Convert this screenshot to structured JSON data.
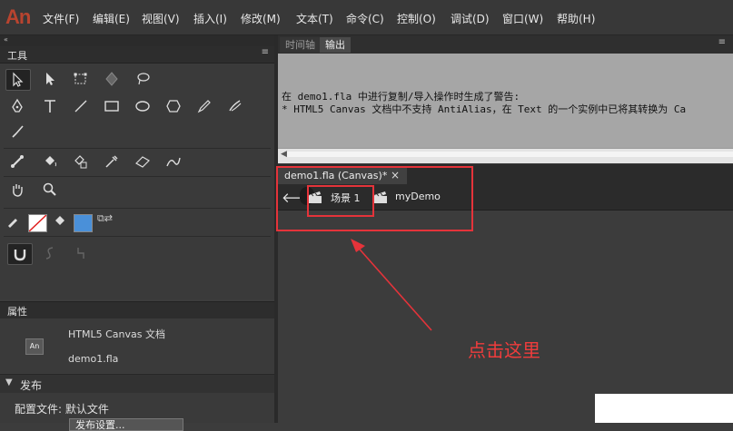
{
  "app": {
    "logo": "An",
    "menu": [
      "文件(F)",
      "编辑(E)",
      "视图(V)",
      "插入(I)",
      "修改(M)",
      "文本(T)",
      "命令(C)",
      "控制(O)",
      "调试(D)",
      "窗口(W)",
      "帮助(H)"
    ]
  },
  "tools_panel": {
    "collapse_icon": "«",
    "title": "工具",
    "menu_icon": "≡",
    "icons": [
      "selection-tool",
      "subselection-tool",
      "free-transform-tool",
      "3d-rotation-tool",
      "lasso-tool",
      "pen-tool",
      "text-tool",
      "line-tool",
      "rectangle-tool",
      "oval-tool",
      "polystar-tool",
      "pencil-tool",
      "brush-tool",
      "paint-brush-tool",
      "bone-tool",
      "paint-bucket-tool",
      "ink-bottle-tool",
      "eyedropper-tool",
      "eraser-tool",
      "width-tool",
      "hand-tool",
      "zoom-tool",
      "stroke-color",
      "fill-color",
      "swap-colors",
      "snap-to-objects",
      "smooth",
      "straighten"
    ],
    "fill_color": "#4a90d9"
  },
  "properties_panel": {
    "title": "属性",
    "doc_type": "HTML5 Canvas 文档",
    "file_name": "demo1.fla",
    "doc_icon_label": "An"
  },
  "publish_panel": {
    "title": "发布",
    "profile_label": "配置文件: 默认文件",
    "settings_button": "发布设置..."
  },
  "output_panel": {
    "tab_timeline": "时间轴",
    "tab_output": "输出",
    "menu_icon": "≡",
    "lines": [
      "在 demo1.fla 中进行复制/导入操作时生成了警告:",
      "* HTML5 Canvas 文档中不支持 AntiAlias，在 Text 的一个实例中已将其转换为 Ca"
    ]
  },
  "document": {
    "tab_label": "demo1.fla (Canvas)*",
    "close": "×",
    "scene_label": "场景 1",
    "symbol_label": "myDemo"
  },
  "annotation": {
    "text": "点击这里",
    "color": "#e5333a"
  }
}
